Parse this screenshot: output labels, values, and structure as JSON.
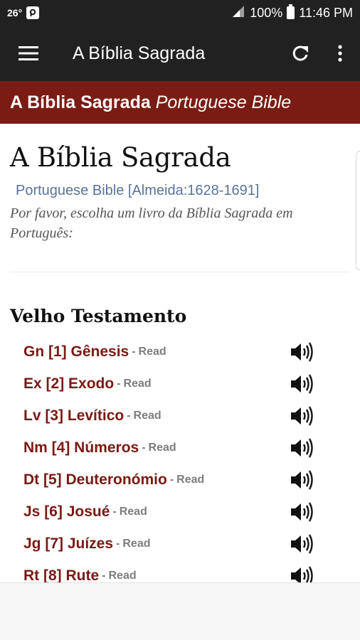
{
  "status_bar": {
    "temperature": "26°",
    "battery": "100%",
    "time": "11:46 PM"
  },
  "app_bar": {
    "title": "A Bíblia Sagrada",
    "menu_icon": "hamburger-menu-icon",
    "refresh_icon": "refresh-icon",
    "more_icon": "more-vert-icon"
  },
  "banner": {
    "title_bold": "A Bíblia Sagrada",
    "title_italic": "Portuguese Bible"
  },
  "main": {
    "title": "A Bíblia Sagrada",
    "subtitle": "Portuguese Bible [Almeida:1628-1691]",
    "instruction": "Por favor, escolha um livro da Bíblia Sagrada em Português:"
  },
  "old_testament": {
    "heading": "Velho Testamento",
    "read_label": "Read",
    "books": [
      {
        "label": "Gn [1] Gênesis"
      },
      {
        "label": "Ex [2] Exodo"
      },
      {
        "label": "Lv [3] Levítico"
      },
      {
        "label": "Nm [4] Números"
      },
      {
        "label": "Dt [5] Deuteronómio"
      },
      {
        "label": "Js [6] Josué"
      },
      {
        "label": "Jg [7] Juízes"
      },
      {
        "label": "Rt [8] Rute"
      }
    ]
  },
  "colors": {
    "app_bar": "#212121",
    "banner": "#7b1c14",
    "book_link": "#7a1a12",
    "subtitle": "#57739c"
  }
}
